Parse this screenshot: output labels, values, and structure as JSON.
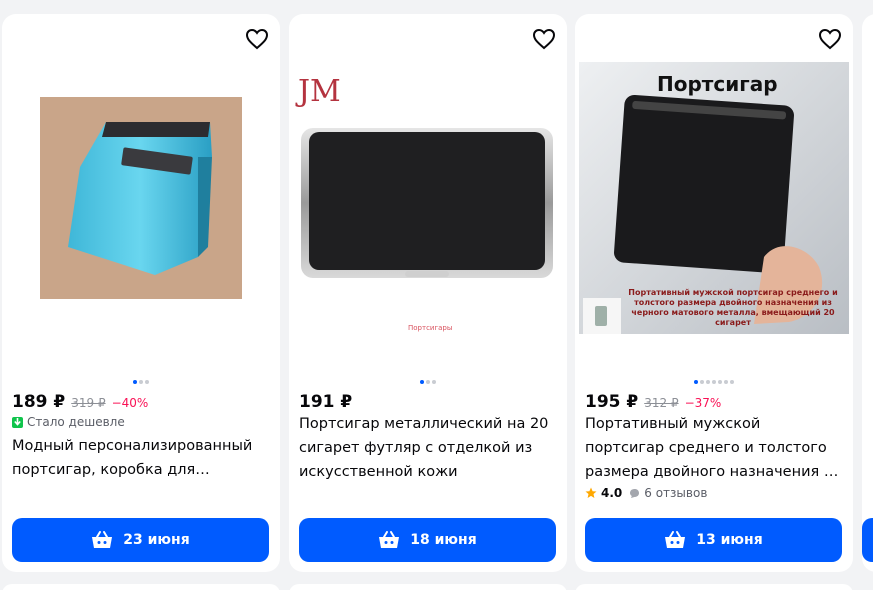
{
  "colors": {
    "accent": "#005bff",
    "discount": "#f91155",
    "cheaper": "#10c44c",
    "star": "#ffa800"
  },
  "products": [
    {
      "price": "189 ₽",
      "old_price": "319 ₽",
      "discount": "−40%",
      "cheaper_label": "Стало дешевле",
      "title": "Модный персонализированный портсигар, коробка для хранени...",
      "delivery": "23 июня",
      "image_dots": 3
    },
    {
      "price": "191 ₽",
      "title": "Портсигар металлический на 20 сигарет футляр с отделкой из искусственной кожи",
      "delivery": "18 июня",
      "image_dots": 3,
      "image_brand": "JM",
      "image_caption": "Портсигары"
    },
    {
      "price": "195 ₽",
      "old_price": "312 ₽",
      "discount": "−37%",
      "title": "Портативный мужской портсигар среднего и толстого размера двойного назначения из черного...",
      "rating": "4.0",
      "reviews": "6 отзывов",
      "delivery": "13 июня",
      "image_dots": 7,
      "image_heading": "Портсигар",
      "image_caption": "Портативный мужской портсигар среднего и толстого размера двойного назначения из черного матового металла, вмещающий 20 сигарет"
    }
  ]
}
